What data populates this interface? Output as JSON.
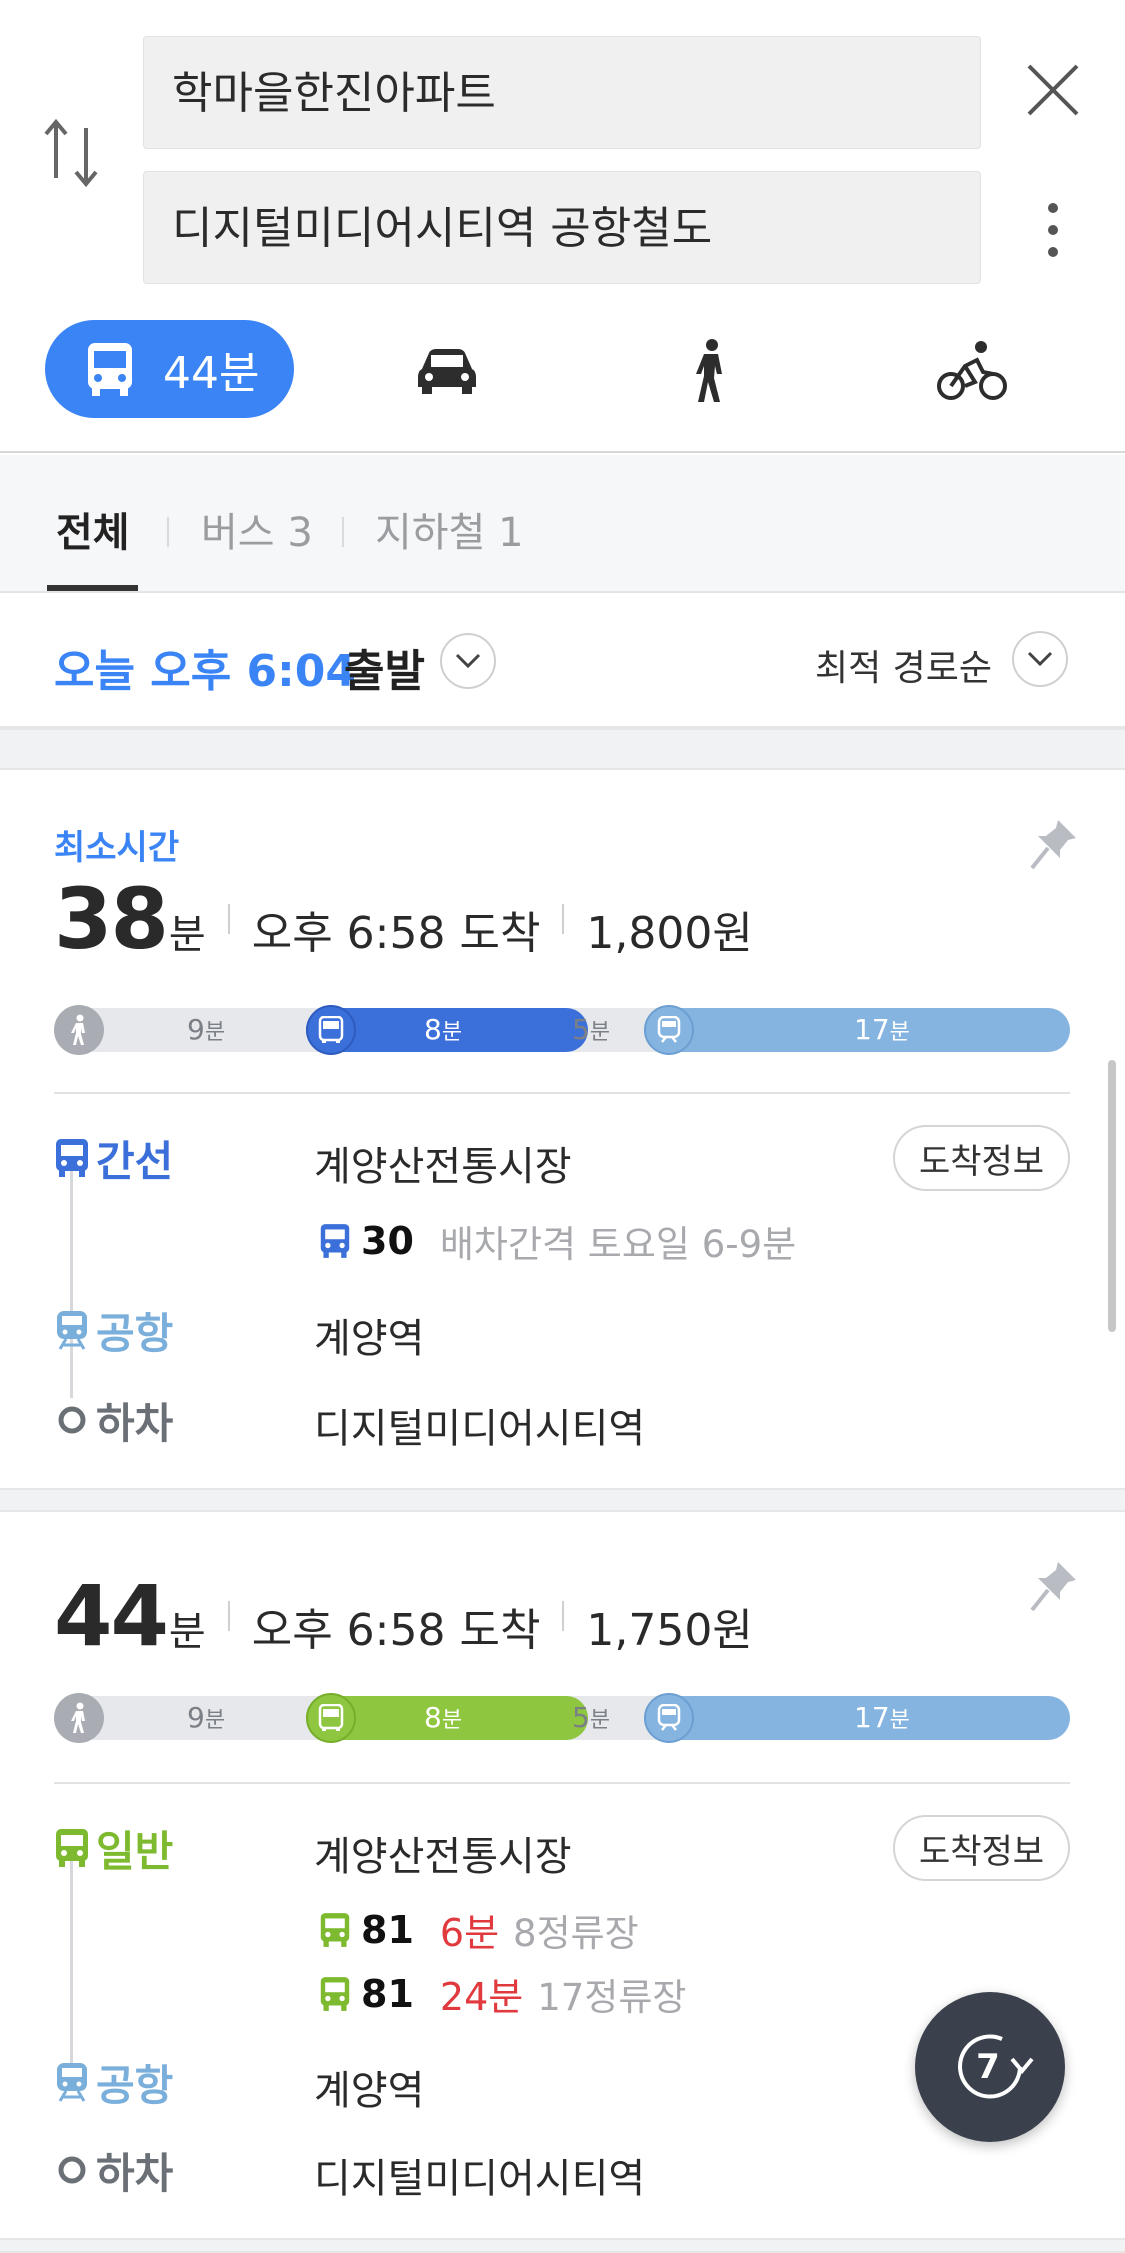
{
  "search": {
    "origin": "학마을한진아파트",
    "destination": "디지털미디어시티역 공항철도"
  },
  "modes": {
    "active_label": "44분",
    "active_icon": "bus-icon",
    "others": [
      "car-icon",
      "walk-icon",
      "bicycle-icon"
    ]
  },
  "tabs": [
    {
      "label": "전체"
    },
    {
      "label": "버스 3"
    },
    {
      "label": "지하철 1"
    }
  ],
  "departure": {
    "time": "오늘 오후 6:04",
    "label": "출발",
    "sort": "최적 경로순"
  },
  "routes": [
    {
      "badge": "최소시간",
      "minutes": "38",
      "min_unit": "분",
      "arrival": "오후 6:58 도착",
      "fare": "1,800원",
      "bar": {
        "walk": "9",
        "bus": "8",
        "wait": "5",
        "train": "17",
        "unit": "분",
        "bus_color": "#3b6fd9",
        "train_color": "#86b4e0"
      },
      "steps": [
        {
          "type": "간선",
          "stop": "계양산전통시장",
          "color": "#3b6fd9"
        },
        {
          "type": "공항",
          "stop": "계양역",
          "color": "#7aaedb"
        },
        {
          "type": "하차",
          "stop": "디지털미디어시티역",
          "color": "#6b6f76"
        }
      ],
      "buses": [
        {
          "number": "30",
          "info": "배차간격 토요일 6-9분",
          "red": ""
        }
      ],
      "arrival_button": "도착정보"
    },
    {
      "badge": "",
      "minutes": "44",
      "min_unit": "분",
      "arrival": "오후 6:58 도착",
      "fare": "1,750원",
      "bar": {
        "walk": "9",
        "bus": "8",
        "wait": "5",
        "train": "17",
        "unit": "분",
        "bus_color": "#8ec63f",
        "train_color": "#86b4e0"
      },
      "steps": [
        {
          "type": "일반",
          "stop": "계양산전통시장",
          "color": "#7dba2f"
        },
        {
          "type": "공항",
          "stop": "계양역",
          "color": "#7aaedb"
        },
        {
          "type": "하차",
          "stop": "디지털미디어시티역",
          "color": "#6b6f76"
        }
      ],
      "buses": [
        {
          "number": "81",
          "red": "6분",
          "info": "8정류장"
        },
        {
          "number": "81",
          "red": "24분",
          "info": "17정류장"
        }
      ],
      "arrival_button": "도착정보"
    }
  ],
  "refresh": {
    "count": "7"
  }
}
